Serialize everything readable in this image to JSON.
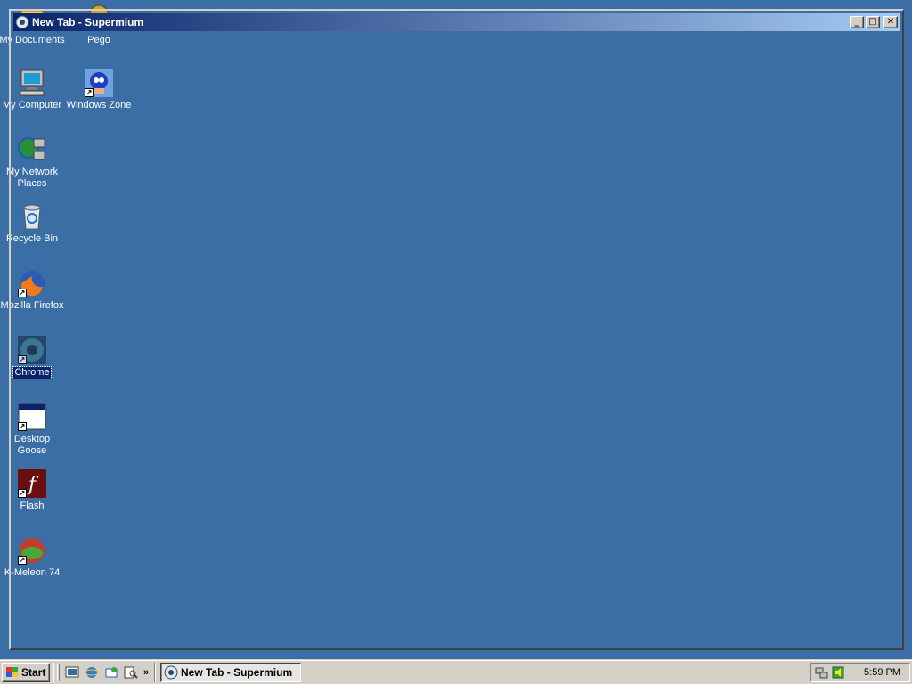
{
  "window": {
    "title": "New Tab - Supermium",
    "minimize_label": "_",
    "maximize_label": "□",
    "close_label": "✕"
  },
  "desktop": {
    "icons": [
      {
        "label": "My Documents",
        "icon": "folder-icon"
      },
      {
        "label": "Pego",
        "icon": "app-icon"
      },
      {
        "label": "My Computer",
        "icon": "computer-icon"
      },
      {
        "label": "Windows Zone",
        "icon": "sonic-icon"
      },
      {
        "label": "My Network Places",
        "icon": "network-icon"
      },
      {
        "label": "Recycle Bin",
        "icon": "recycle-bin-icon"
      },
      {
        "label": "Mozilla Firefox",
        "icon": "firefox-icon"
      },
      {
        "label": "Chrome",
        "icon": "chrome-icon"
      },
      {
        "label": "Desktop Goose",
        "icon": "window-icon"
      },
      {
        "label": "Flash",
        "icon": "flash-icon"
      },
      {
        "label": "K-Meleon 74",
        "icon": "kmeleon-icon"
      }
    ]
  },
  "taskbar": {
    "start_label": "Start",
    "task_label": "New Tab - Supermium",
    "overflow_label": "»",
    "clock": "5:59 PM"
  },
  "colors": {
    "desktop": "#3a6ea5",
    "titlebar_start": "#0a246a",
    "titlebar_end": "#a6caf0",
    "face": "#d4d0c8"
  }
}
